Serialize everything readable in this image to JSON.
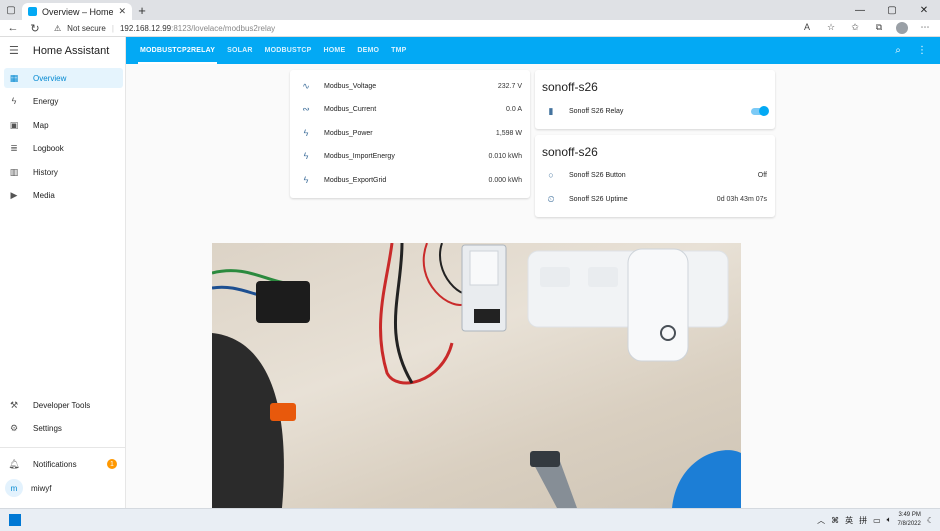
{
  "browser": {
    "tab_title": "Overview – Home Assistant",
    "tab_close": "✕",
    "new_tab": "+",
    "security": "Not secure",
    "url_host": "192.168.12.99",
    "url_path": ":8123/lovelace/modbus2relay"
  },
  "sidebar": {
    "title": "Home Assistant",
    "items": [
      {
        "label": "Overview"
      },
      {
        "label": "Energy"
      },
      {
        "label": "Map"
      },
      {
        "label": "Logbook"
      },
      {
        "label": "History"
      },
      {
        "label": "Media"
      }
    ],
    "bottom": [
      {
        "label": "Developer Tools"
      },
      {
        "label": "Settings"
      },
      {
        "label": "Notifications",
        "badge": "1"
      },
      {
        "label": "miwyf",
        "avatar": "m"
      }
    ]
  },
  "header": {
    "tabs": [
      {
        "label": "MODBUSTCP2RELAY",
        "active": true
      },
      {
        "label": "SOLAR"
      },
      {
        "label": "MODBUSTCP"
      },
      {
        "label": "HOME"
      },
      {
        "label": "DEMO"
      },
      {
        "label": "TMP"
      }
    ]
  },
  "modbus_card": {
    "rows": [
      {
        "name": "Modbus_Voltage",
        "value": "232.7 V",
        "icon": "sine-wave-icon"
      },
      {
        "name": "Modbus_Current",
        "value": "0.0 A",
        "icon": "current-ac-icon"
      },
      {
        "name": "Modbus_Power",
        "value": "1,598 W",
        "icon": "flash-icon"
      },
      {
        "name": "Modbus_ImportEnergy",
        "value": "0.010 kWh",
        "icon": "flash-icon"
      },
      {
        "name": "Modbus_ExportGrid",
        "value": "0.000 kWh",
        "icon": "flash-icon"
      }
    ]
  },
  "sonoff_card_1": {
    "title": "sonoff-s26",
    "rows": [
      {
        "name": "Sonoff S26 Relay",
        "state": "on",
        "icon": "power-socket-icon"
      }
    ]
  },
  "sonoff_card_2": {
    "title": "sonoff-s26",
    "rows": [
      {
        "name": "Sonoff S26 Button",
        "value": "Off",
        "icon": "circle-outline-icon"
      },
      {
        "name": "Sonoff S26 Uptime",
        "value": "0d 03h 43m 07s",
        "icon": "timer-icon"
      }
    ]
  },
  "taskbar": {
    "ime_1": "英",
    "ime_2": "拼",
    "time": "3:49 PM",
    "date": "7/8/2022"
  },
  "colors": {
    "primary": "#03a9f4",
    "sidebar_active_bg": "#e5f4fd",
    "badge": "#ff9800",
    "state_icon": "#44739e"
  }
}
